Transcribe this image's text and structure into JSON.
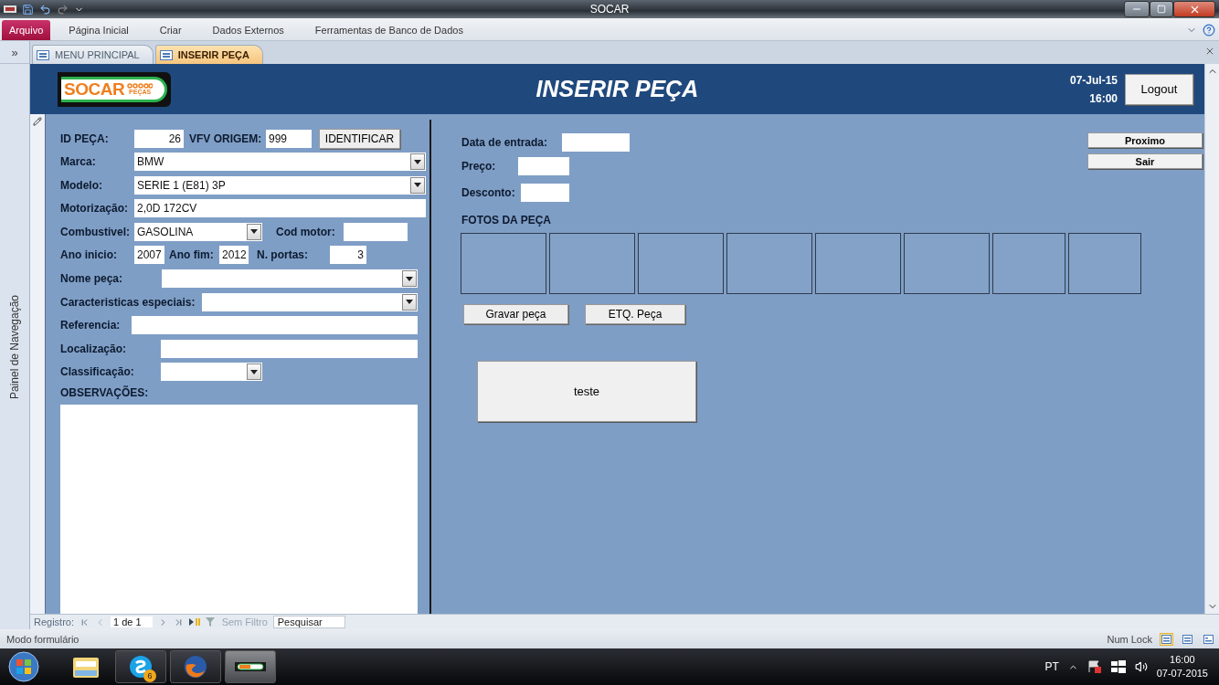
{
  "window": {
    "title": "SOCAR"
  },
  "ribbon_tabs": [
    {
      "label": "Arquivo",
      "selected": true
    },
    {
      "label": "Página Inicial",
      "selected": false
    },
    {
      "label": "Criar",
      "selected": false
    },
    {
      "label": "Dados Externos",
      "selected": false
    },
    {
      "label": "Ferramentas de Banco de Dados",
      "selected": false
    }
  ],
  "document_tabs": [
    {
      "label": "MENU PRINCIPAL",
      "selected": false
    },
    {
      "label": "INSERIR PEÇA",
      "selected": true
    }
  ],
  "navigation_pane": {
    "label": "Painel de Navegação",
    "toggle": "»"
  },
  "form": {
    "logo": {
      "name": "SOCAR",
      "tagline": "PEÇAS"
    },
    "title": "INSERIR PEÇA",
    "date": "07-Jul-15",
    "time": "16:00",
    "logout_button": "Logout",
    "left_rows": [
      {
        "items": [
          {
            "kind": "label",
            "text": "ID PEÇA:"
          },
          {
            "kind": "number",
            "value": "26"
          },
          {
            "kind": "label",
            "text": "VFV ORIGEM:"
          },
          {
            "kind": "input",
            "value": "999"
          },
          {
            "kind": "button",
            "text": "IDENTIFICAR"
          }
        ]
      },
      {
        "items": [
          {
            "kind": "label",
            "text": "Marca:"
          },
          {
            "kind": "combo",
            "value": "BMW"
          }
        ]
      },
      {
        "items": [
          {
            "kind": "label",
            "text": "Modelo:"
          },
          {
            "kind": "combo",
            "value": "SERIE 1 (E81) 3P"
          }
        ]
      },
      {
        "items": [
          {
            "kind": "label",
            "text": "Motorização:"
          },
          {
            "kind": "input",
            "value": "2,0D 172CV"
          }
        ]
      },
      {
        "items": [
          {
            "kind": "label",
            "text": "Combustivel:"
          },
          {
            "kind": "combo",
            "value": "GASOLINA"
          },
          {
            "kind": "label",
            "text": "Cod motor:"
          },
          {
            "kind": "input"
          }
        ]
      },
      {
        "items": [
          {
            "kind": "label",
            "text": "Ano inicio:"
          },
          {
            "kind": "input",
            "value": "2007"
          },
          {
            "kind": "label",
            "text": "Ano fim:"
          },
          {
            "kind": "input",
            "value": "2012"
          },
          {
            "kind": "label",
            "text": "N. portas:"
          },
          {
            "kind": "number",
            "value": "3"
          }
        ]
      },
      {
        "items": [
          {
            "kind": "label",
            "text": "Nome peça:"
          },
          {
            "kind": "combo"
          }
        ]
      },
      {
        "items": [
          {
            "kind": "label",
            "text": "Caracteristicas especiais:"
          },
          {
            "kind": "combo"
          }
        ]
      },
      {
        "items": [
          {
            "kind": "label",
            "text": "Referencia:"
          },
          {
            "kind": "input"
          }
        ]
      },
      {
        "items": [
          {
            "kind": "label",
            "text": "Localização:"
          },
          {
            "kind": "input"
          }
        ]
      },
      {
        "items": [
          {
            "kind": "label",
            "text": "Classificação:"
          },
          {
            "kind": "combo"
          }
        ]
      }
    ],
    "observations_label": "OBSERVAÇÕES:",
    "right_fields": [
      {
        "label": "Data de entrada:"
      },
      {
        "label": "Preço:"
      },
      {
        "label": "Desconto:"
      }
    ],
    "photos_label": "FOTOS DA PEÇA",
    "photo_slots": [
      {
        "kind": "empty"
      },
      {
        "kind": "empty"
      },
      {
        "kind": "empty"
      },
      {
        "kind": "empty"
      },
      {
        "kind": "empty"
      },
      {
        "kind": "empty"
      },
      {
        "kind": "empty"
      },
      {
        "kind": "empty"
      }
    ],
    "action_buttons": [
      "Gravar peça",
      "ETQ. Peça"
    ],
    "big_button": "teste",
    "side_buttons": [
      "Proximo",
      "Sair"
    ]
  },
  "record_navigator": {
    "label": "Registro:",
    "position": "1 de 1",
    "filter": "Sem Filtro",
    "search_placeholder": "Pesquisar"
  },
  "status_bar": {
    "mode": "Modo formulário",
    "num_lock": "Num Lock",
    "views": [
      {
        "selected": true
      },
      {
        "selected": false
      },
      {
        "selected": false
      }
    ]
  },
  "taskbar": {
    "apps": [
      {
        "kind": "folder",
        "running": false,
        "active": false
      },
      {
        "kind": "chat",
        "running": true,
        "active": false,
        "badge": "6"
      },
      {
        "kind": "browser",
        "running": true,
        "active": false
      },
      {
        "kind": "database",
        "running": true,
        "active": true
      }
    ],
    "language": "PT",
    "time": "16:00",
    "date": "07-07-2015"
  }
}
